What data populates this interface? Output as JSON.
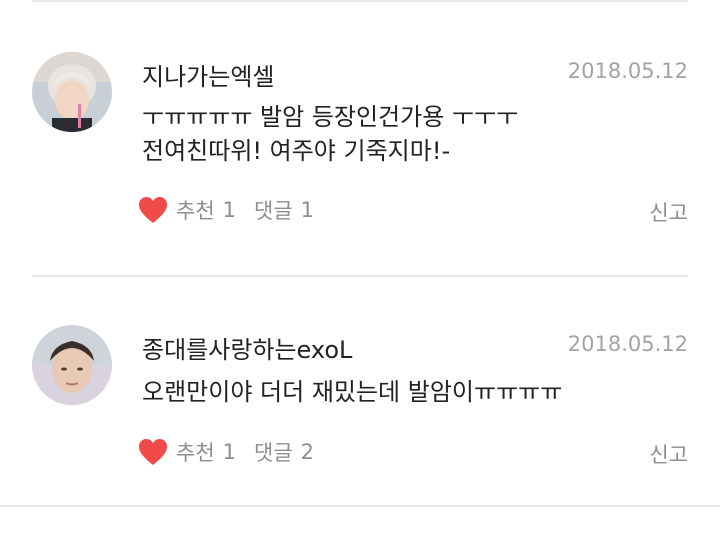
{
  "comments": [
    {
      "avatar_icon": "profile-photo-blond-boy",
      "username": "지나가는엑셀",
      "date": "2018.05.12",
      "lines": [
        "ㅜㅠㅠㅠㅠ 발암 등장인건가용 ㅜㅜㅜ",
        "전여친따위! 여주야 기죽지마!-"
      ],
      "like_icon": "heart-icon",
      "like_label": "추천",
      "like_count": "1",
      "reply_label": "댓글",
      "reply_count": "1",
      "report_label": "신고"
    },
    {
      "avatar_icon": "profile-photo-dark-hair-boy",
      "username": "종대를사랑하는exoL",
      "date": "2018.05.12",
      "lines": [
        "오랜만이야 더더 재밌는데 발암이ㅠㅠㅠㅠ"
      ],
      "like_icon": "heart-icon",
      "like_label": "추천",
      "like_count": "1",
      "reply_label": "댓글",
      "reply_count": "2",
      "report_label": "신고"
    }
  ],
  "colors": {
    "heart": "#f04a4a",
    "meta_text": "#8e8e8e",
    "date_text": "#a3a3a3",
    "divider": "#e6e6e6"
  }
}
